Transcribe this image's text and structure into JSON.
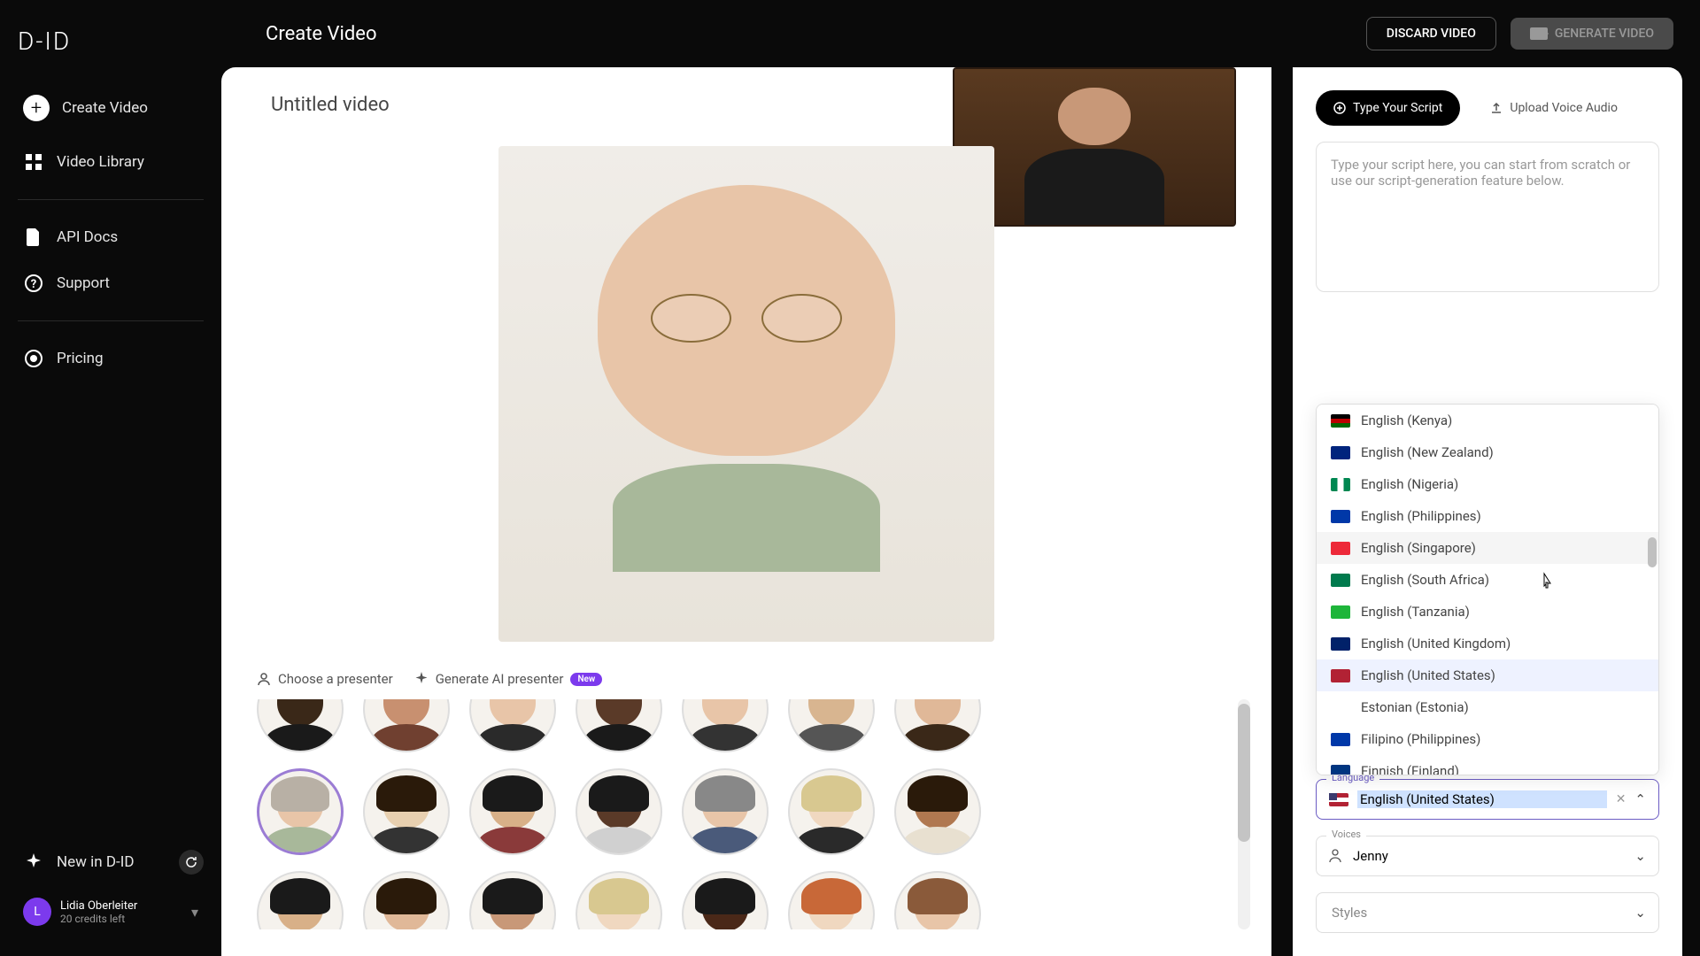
{
  "app": {
    "logo": "D-ID"
  },
  "header": {
    "title": "Create Video",
    "discard": "DISCARD VIDEO",
    "generate": "GENERATE VIDEO"
  },
  "sidebar": {
    "create": "Create Video",
    "library": "Video Library",
    "api": "API Docs",
    "support": "Support",
    "pricing": "Pricing",
    "new_in": "New in D-ID"
  },
  "user": {
    "initial": "L",
    "name": "Lidia Oberleiter",
    "credits": "20 credits left"
  },
  "canvas": {
    "video_title": "Untitled video",
    "choose_presenter": "Choose a presenter",
    "generate_ai": "Generate AI presenter",
    "new_badge": "New"
  },
  "script": {
    "tab_type": "Type Your Script",
    "tab_upload": "Upload Voice Audio",
    "placeholder": "Type your script here, you can start from scratch or use our script-generation feature below."
  },
  "language_dropdown": {
    "items": [
      {
        "flag": "#000",
        "stripes": [
          "#000",
          "#b00",
          "#060"
        ],
        "label": "English (Kenya)"
      },
      {
        "flag": "#00247d",
        "label": "English (New Zealand)"
      },
      {
        "flag": "#008751",
        "tricolor": [
          "#008751",
          "#fff",
          "#008751"
        ],
        "label": "English (Nigeria)"
      },
      {
        "flag": "#0038a8",
        "label": "English (Philippines)"
      },
      {
        "flag": "#ed2939",
        "label": "English (Singapore)"
      },
      {
        "flag": "#007a4d",
        "label": "English (South Africa)"
      },
      {
        "flag": "#1eb53a",
        "label": "English (Tanzania)"
      },
      {
        "flag": "#012169",
        "label": "English (United Kingdom)"
      },
      {
        "flag": "#b22234",
        "label": "English (United States)"
      },
      {
        "flag": "#fff",
        "label": "Estonian (Estonia)"
      },
      {
        "flag": "#0038a8",
        "label": "Filipino (Philippines)"
      },
      {
        "flag": "#003580",
        "label": "Finnish (Finland)"
      }
    ],
    "selected_index": 8,
    "hover_index": 4
  },
  "fields": {
    "language_label": "Language",
    "language_value": "English (United States)",
    "voices_label": "Voices",
    "voices_value": "Jenny",
    "styles_label": "Styles"
  },
  "avatars": {
    "row0": [
      {
        "skin": "#3a2818",
        "top": "#1a1a1a"
      },
      {
        "skin": "#c89070",
        "top": "#704030"
      },
      {
        "skin": "#e8c5a8",
        "top": "#2a2a2a"
      },
      {
        "skin": "#5a3a28",
        "top": "#1a1a1a"
      },
      {
        "skin": "#e8c5a8",
        "top": "#333"
      },
      {
        "skin": "#d8b590",
        "top": "#555"
      },
      {
        "skin": "#e0b898",
        "top": "#3a2818"
      }
    ],
    "row1": [
      {
        "skin": "#e8c5a8",
        "top": "#a8b89a",
        "hair": "#b8b0a5",
        "selected": true
      },
      {
        "skin": "#e8d0b0",
        "top": "#333",
        "hair": "#2a1a0a"
      },
      {
        "skin": "#d8b088",
        "top": "#8a3a3a",
        "hair": "#1a1a1a"
      },
      {
        "skin": "#5a3a28",
        "top": "#d0d0d0",
        "hair": "#1a1a1a"
      },
      {
        "skin": "#e8c5a8",
        "top": "#4a5a7a",
        "hair": "#888"
      },
      {
        "skin": "#f0d8c0",
        "top": "#2a2a2a",
        "hair": "#d8c890"
      },
      {
        "skin": "#b07850",
        "top": "#e8e0d0",
        "hair": "#2a1a0a"
      }
    ],
    "row2": [
      {
        "skin": "#d8b088",
        "top": "#f0f0f0",
        "hair": "#1a1a1a"
      },
      {
        "skin": "#e0b898",
        "top": "#333",
        "hair": "#2a1a0a"
      },
      {
        "skin": "#c89878",
        "top": "#2a2a2a",
        "hair": "#1a1a1a"
      },
      {
        "skin": "#f0d8c0",
        "top": "#b8a888",
        "hair": "#d8c890"
      },
      {
        "skin": "#4a2818",
        "top": "#8a9a6a",
        "hair": "#1a1a1a"
      },
      {
        "skin": "#f0d8c0",
        "top": "#f0f0f0",
        "hair": "#c86838"
      },
      {
        "skin": "#e8c5a8",
        "top": "#6a4a3a",
        "hair": "#8a5a3a"
      }
    ]
  }
}
